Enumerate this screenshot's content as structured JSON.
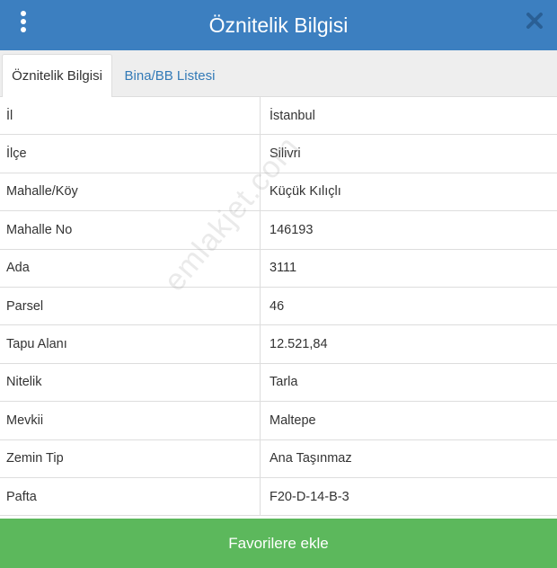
{
  "header": {
    "title": "Öznitelik Bilgisi",
    "menu_icon": "vertical-dots-icon",
    "close_icon": "close-icon"
  },
  "tabs": [
    {
      "label": "Öznitelik Bilgisi",
      "active": true
    },
    {
      "label": "Bina/BB Listesi",
      "active": false
    }
  ],
  "attributes": [
    {
      "key": "İl",
      "value": "İstanbul"
    },
    {
      "key": "İlçe",
      "value": "Silivri"
    },
    {
      "key": "Mahalle/Köy",
      "value": "Küçük Kılıçlı"
    },
    {
      "key": "Mahalle No",
      "value": "146193"
    },
    {
      "key": "Ada",
      "value": "3111"
    },
    {
      "key": "Parsel",
      "value": "46"
    },
    {
      "key": "Tapu Alanı",
      "value": "12.521,84"
    },
    {
      "key": "Nitelik",
      "value": "Tarla"
    },
    {
      "key": "Mevkii",
      "value": "Maltepe"
    },
    {
      "key": "Zemin Tip",
      "value": "Ana Taşınmaz"
    },
    {
      "key": "Pafta",
      "value": "F20-D-14-B-3"
    }
  ],
  "watermark": "emlakjet.com",
  "footer": {
    "button_label": "Favorilere ekle"
  },
  "colors": {
    "header": "#3c7fc0",
    "footer": "#5cb85c",
    "link": "#337ab7"
  }
}
